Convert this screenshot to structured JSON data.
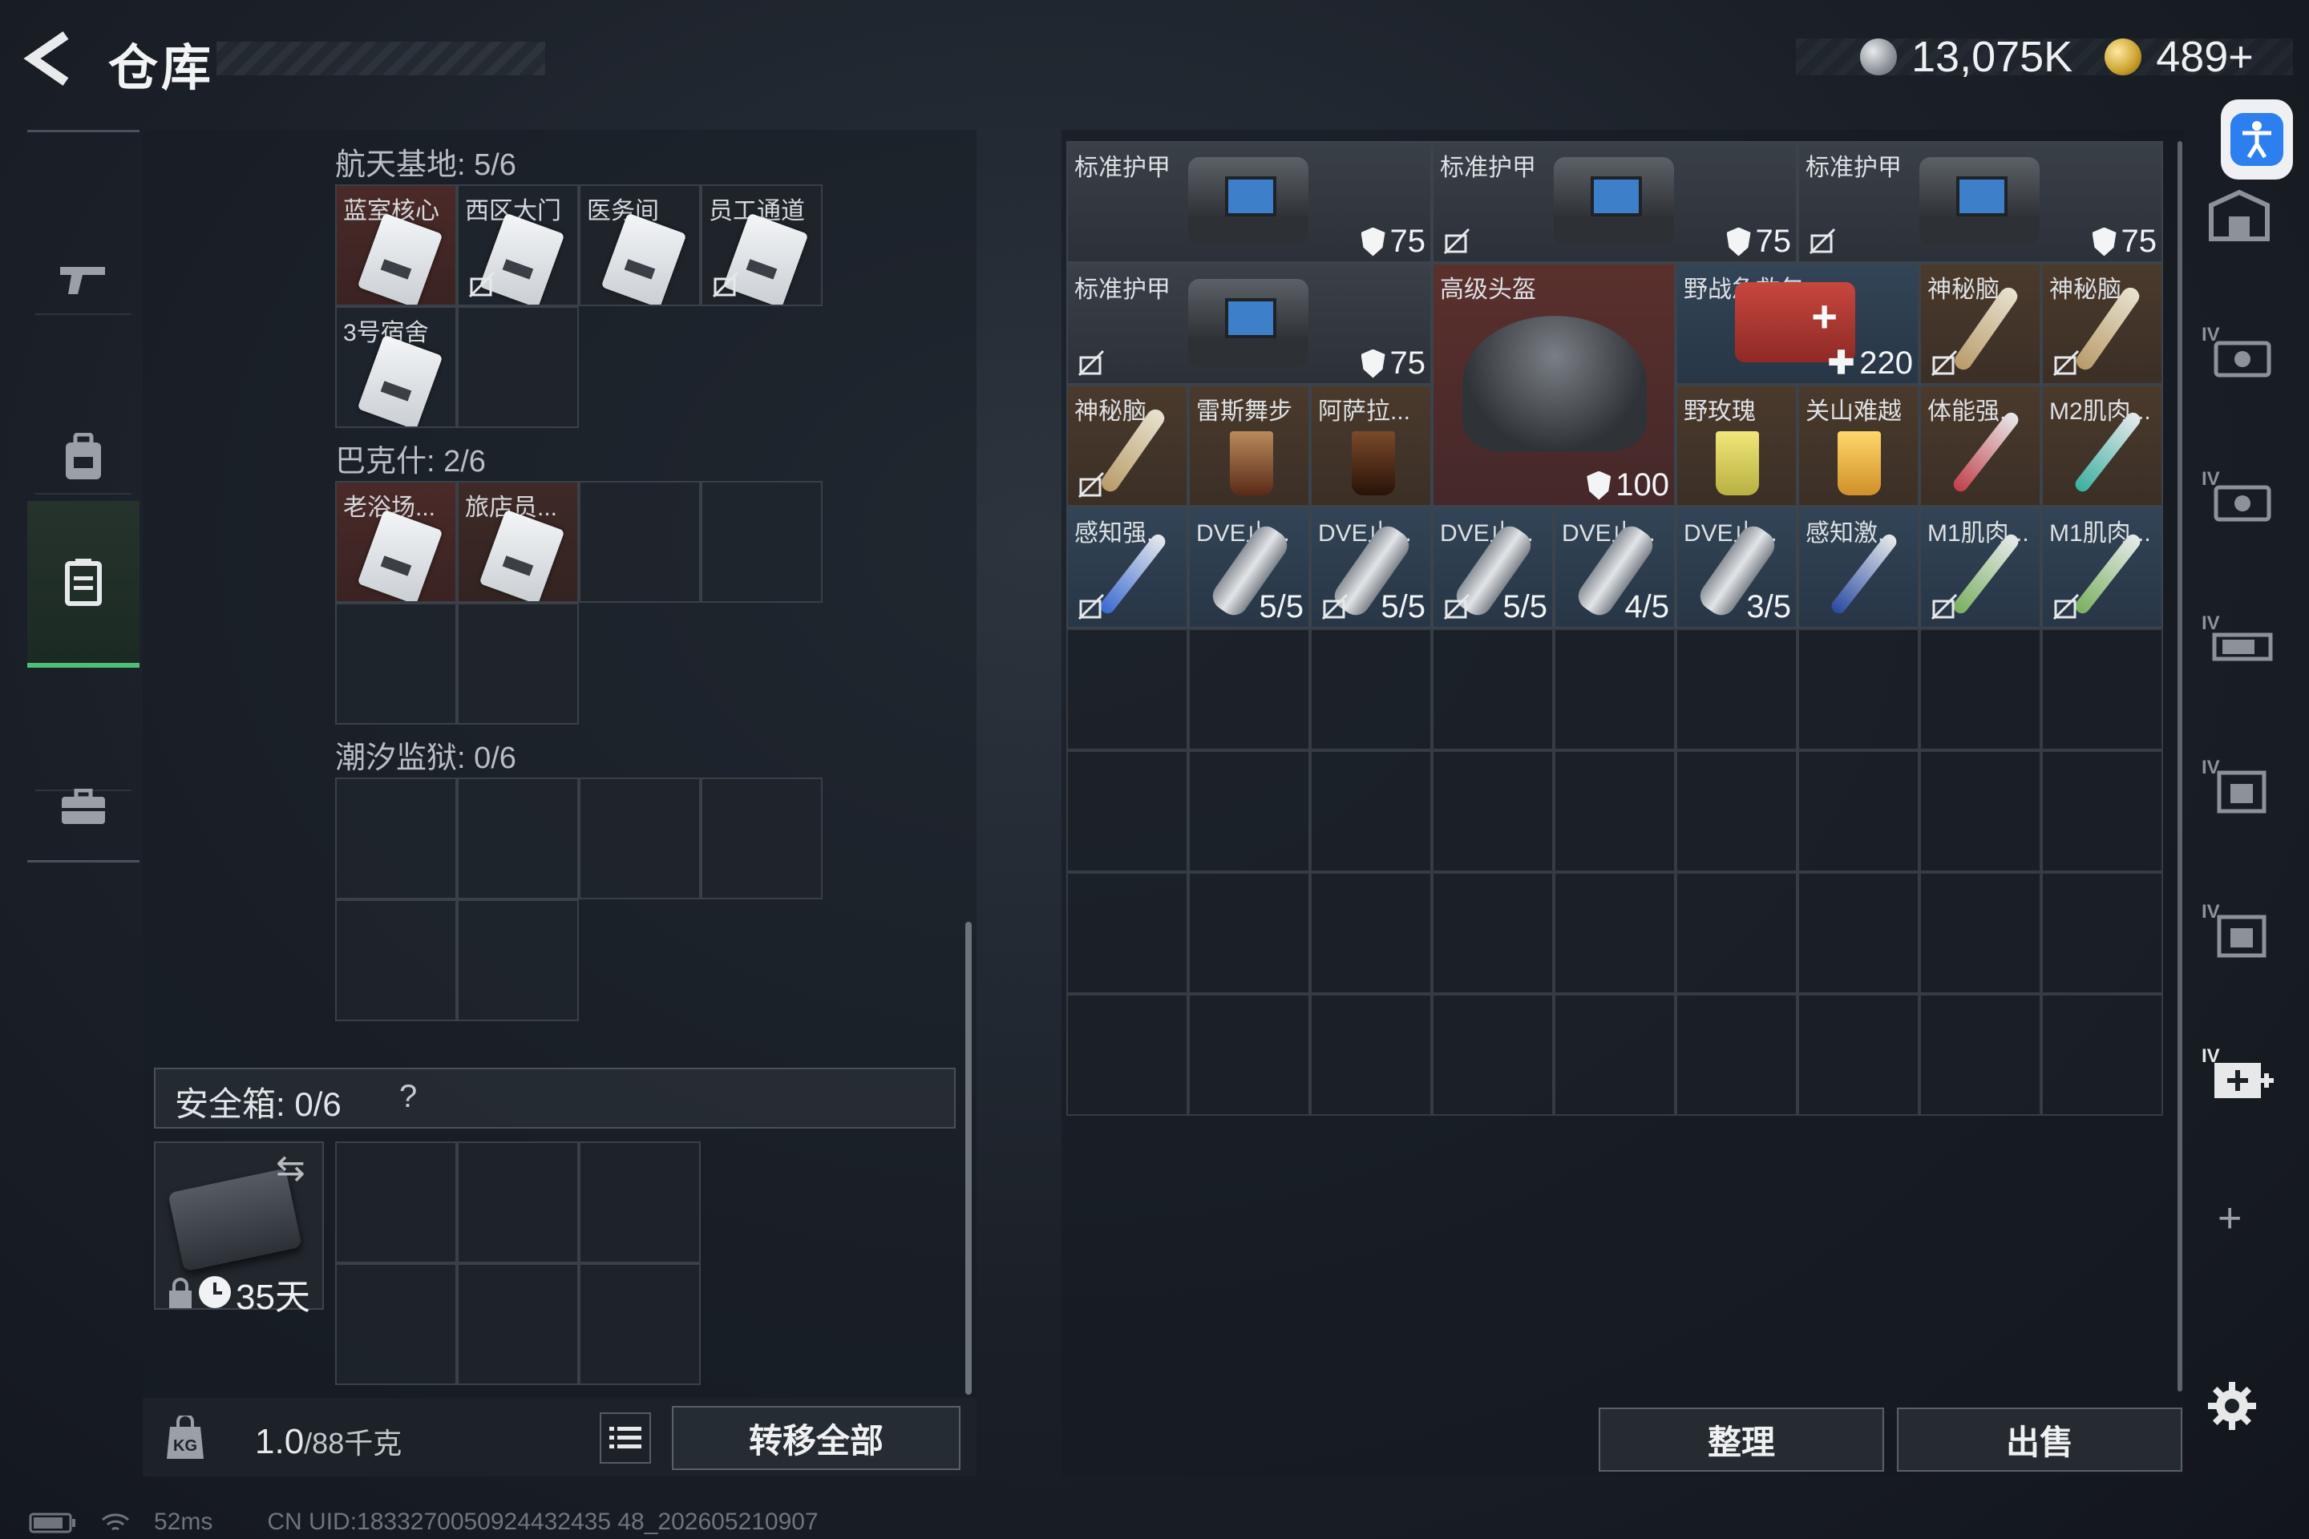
{
  "header": {
    "title": "仓库",
    "silver_amount": "13,075K",
    "gold_amount": "489+"
  },
  "sidebar": {
    "items": [
      {
        "icon": "gun-icon"
      },
      {
        "icon": "backpack-icon"
      },
      {
        "icon": "storage-box-icon",
        "active": true
      },
      {
        "icon": "briefcase-icon"
      }
    ]
  },
  "left": {
    "sections": [
      {
        "title": "航天基地: 5/6",
        "cells": [
          "蓝室核心",
          "西区大门",
          "医务间",
          "员工通道",
          "3号宿舍",
          ""
        ]
      },
      {
        "title": "巴克什: 2/6",
        "cells": [
          "老浴场...",
          "旅店员...",
          "",
          "",
          "",
          ""
        ]
      },
      {
        "title": "潮汐监狱: 0/6",
        "cells": [
          "",
          "",
          "",
          "",
          "",
          ""
        ]
      }
    ]
  },
  "safe": {
    "title": "安全箱:",
    "count": "0/6",
    "help": "?",
    "days": "35天"
  },
  "bottom_left": {
    "weight": "1.0",
    "weight_max": "/88千克",
    "transfer_all": "转移全部"
  },
  "bottom_right": {
    "sort": "整理",
    "sell": "出售"
  },
  "items": {
    "armor1": {
      "name": "标准护甲",
      "value": "75"
    },
    "armor2": {
      "name": "标准护甲",
      "value": "75"
    },
    "armor3": {
      "name": "标准护甲",
      "value": "75"
    },
    "armor4": {
      "name": "标准护甲",
      "value": "75"
    },
    "helmet": {
      "name": "高级头盔",
      "value": "100"
    },
    "medkit": {
      "name": "野战急救包",
      "value": "220"
    },
    "brain1": {
      "name": "神秘脑..."
    },
    "brain2": {
      "name": "神秘脑..."
    },
    "brain3": {
      "name": "神秘脑..."
    },
    "drink1": {
      "name": "雷斯舞步"
    },
    "drink2": {
      "name": "阿萨拉..."
    },
    "drink3": {
      "name": "野玫瑰"
    },
    "drink4": {
      "name": "关山难越"
    },
    "syr1": {
      "name": "体能强..."
    },
    "syr2": {
      "name": "M2肌肉..."
    },
    "syr3": {
      "name": "感知强..."
    },
    "dve1": {
      "name": "DVE止...",
      "value": "5/5"
    },
    "dve2": {
      "name": "DVE止...",
      "value": "5/5"
    },
    "dve3": {
      "name": "DVE止...",
      "value": "5/5"
    },
    "dve4": {
      "name": "DVE止...",
      "value": "4/5"
    },
    "dve5": {
      "name": "DVE止...",
      "value": "3/5"
    },
    "syr4": {
      "name": "感知激..."
    },
    "syr5": {
      "name": "M1肌肉..."
    },
    "syr6": {
      "name": "M1肌肉..."
    }
  },
  "right_sidebar": {
    "labels": [
      "IV",
      "IV",
      "IV",
      "IV",
      "IV",
      "IV"
    ]
  },
  "status": {
    "ping": "52ms",
    "uid": "CN UID:1833270050924432435 48_202605210907"
  },
  "colors": {
    "active_green": "#4fbf78",
    "accent_blue": "#2d7ff0"
  }
}
